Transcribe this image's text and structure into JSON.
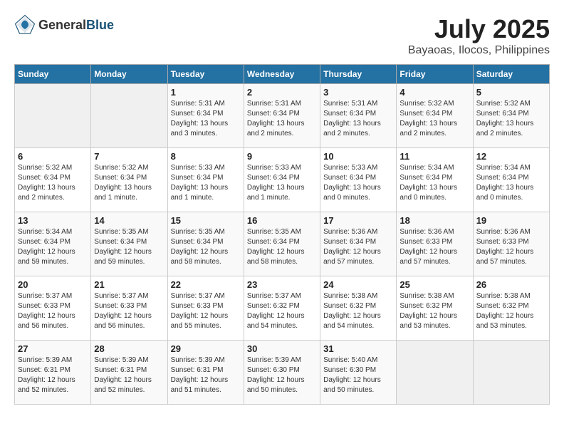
{
  "header": {
    "logo_general": "General",
    "logo_blue": "Blue",
    "month": "July 2025",
    "location": "Bayaoas, Ilocos, Philippines"
  },
  "days_of_week": [
    "Sunday",
    "Monday",
    "Tuesday",
    "Wednesday",
    "Thursday",
    "Friday",
    "Saturday"
  ],
  "weeks": [
    [
      {
        "day": "",
        "info": ""
      },
      {
        "day": "",
        "info": ""
      },
      {
        "day": "1",
        "info": "Sunrise: 5:31 AM\nSunset: 6:34 PM\nDaylight: 13 hours and 3 minutes."
      },
      {
        "day": "2",
        "info": "Sunrise: 5:31 AM\nSunset: 6:34 PM\nDaylight: 13 hours and 2 minutes."
      },
      {
        "day": "3",
        "info": "Sunrise: 5:31 AM\nSunset: 6:34 PM\nDaylight: 13 hours and 2 minutes."
      },
      {
        "day": "4",
        "info": "Sunrise: 5:32 AM\nSunset: 6:34 PM\nDaylight: 13 hours and 2 minutes."
      },
      {
        "day": "5",
        "info": "Sunrise: 5:32 AM\nSunset: 6:34 PM\nDaylight: 13 hours and 2 minutes."
      }
    ],
    [
      {
        "day": "6",
        "info": "Sunrise: 5:32 AM\nSunset: 6:34 PM\nDaylight: 13 hours and 2 minutes."
      },
      {
        "day": "7",
        "info": "Sunrise: 5:32 AM\nSunset: 6:34 PM\nDaylight: 13 hours and 1 minute."
      },
      {
        "day": "8",
        "info": "Sunrise: 5:33 AM\nSunset: 6:34 PM\nDaylight: 13 hours and 1 minute."
      },
      {
        "day": "9",
        "info": "Sunrise: 5:33 AM\nSunset: 6:34 PM\nDaylight: 13 hours and 1 minute."
      },
      {
        "day": "10",
        "info": "Sunrise: 5:33 AM\nSunset: 6:34 PM\nDaylight: 13 hours and 0 minutes."
      },
      {
        "day": "11",
        "info": "Sunrise: 5:34 AM\nSunset: 6:34 PM\nDaylight: 13 hours and 0 minutes."
      },
      {
        "day": "12",
        "info": "Sunrise: 5:34 AM\nSunset: 6:34 PM\nDaylight: 13 hours and 0 minutes."
      }
    ],
    [
      {
        "day": "13",
        "info": "Sunrise: 5:34 AM\nSunset: 6:34 PM\nDaylight: 12 hours and 59 minutes."
      },
      {
        "day": "14",
        "info": "Sunrise: 5:35 AM\nSunset: 6:34 PM\nDaylight: 12 hours and 59 minutes."
      },
      {
        "day": "15",
        "info": "Sunrise: 5:35 AM\nSunset: 6:34 PM\nDaylight: 12 hours and 58 minutes."
      },
      {
        "day": "16",
        "info": "Sunrise: 5:35 AM\nSunset: 6:34 PM\nDaylight: 12 hours and 58 minutes."
      },
      {
        "day": "17",
        "info": "Sunrise: 5:36 AM\nSunset: 6:34 PM\nDaylight: 12 hours and 57 minutes."
      },
      {
        "day": "18",
        "info": "Sunrise: 5:36 AM\nSunset: 6:33 PM\nDaylight: 12 hours and 57 minutes."
      },
      {
        "day": "19",
        "info": "Sunrise: 5:36 AM\nSunset: 6:33 PM\nDaylight: 12 hours and 57 minutes."
      }
    ],
    [
      {
        "day": "20",
        "info": "Sunrise: 5:37 AM\nSunset: 6:33 PM\nDaylight: 12 hours and 56 minutes."
      },
      {
        "day": "21",
        "info": "Sunrise: 5:37 AM\nSunset: 6:33 PM\nDaylight: 12 hours and 56 minutes."
      },
      {
        "day": "22",
        "info": "Sunrise: 5:37 AM\nSunset: 6:33 PM\nDaylight: 12 hours and 55 minutes."
      },
      {
        "day": "23",
        "info": "Sunrise: 5:37 AM\nSunset: 6:32 PM\nDaylight: 12 hours and 54 minutes."
      },
      {
        "day": "24",
        "info": "Sunrise: 5:38 AM\nSunset: 6:32 PM\nDaylight: 12 hours and 54 minutes."
      },
      {
        "day": "25",
        "info": "Sunrise: 5:38 AM\nSunset: 6:32 PM\nDaylight: 12 hours and 53 minutes."
      },
      {
        "day": "26",
        "info": "Sunrise: 5:38 AM\nSunset: 6:32 PM\nDaylight: 12 hours and 53 minutes."
      }
    ],
    [
      {
        "day": "27",
        "info": "Sunrise: 5:39 AM\nSunset: 6:31 PM\nDaylight: 12 hours and 52 minutes."
      },
      {
        "day": "28",
        "info": "Sunrise: 5:39 AM\nSunset: 6:31 PM\nDaylight: 12 hours and 52 minutes."
      },
      {
        "day": "29",
        "info": "Sunrise: 5:39 AM\nSunset: 6:31 PM\nDaylight: 12 hours and 51 minutes."
      },
      {
        "day": "30",
        "info": "Sunrise: 5:39 AM\nSunset: 6:30 PM\nDaylight: 12 hours and 50 minutes."
      },
      {
        "day": "31",
        "info": "Sunrise: 5:40 AM\nSunset: 6:30 PM\nDaylight: 12 hours and 50 minutes."
      },
      {
        "day": "",
        "info": ""
      },
      {
        "day": "",
        "info": ""
      }
    ]
  ]
}
